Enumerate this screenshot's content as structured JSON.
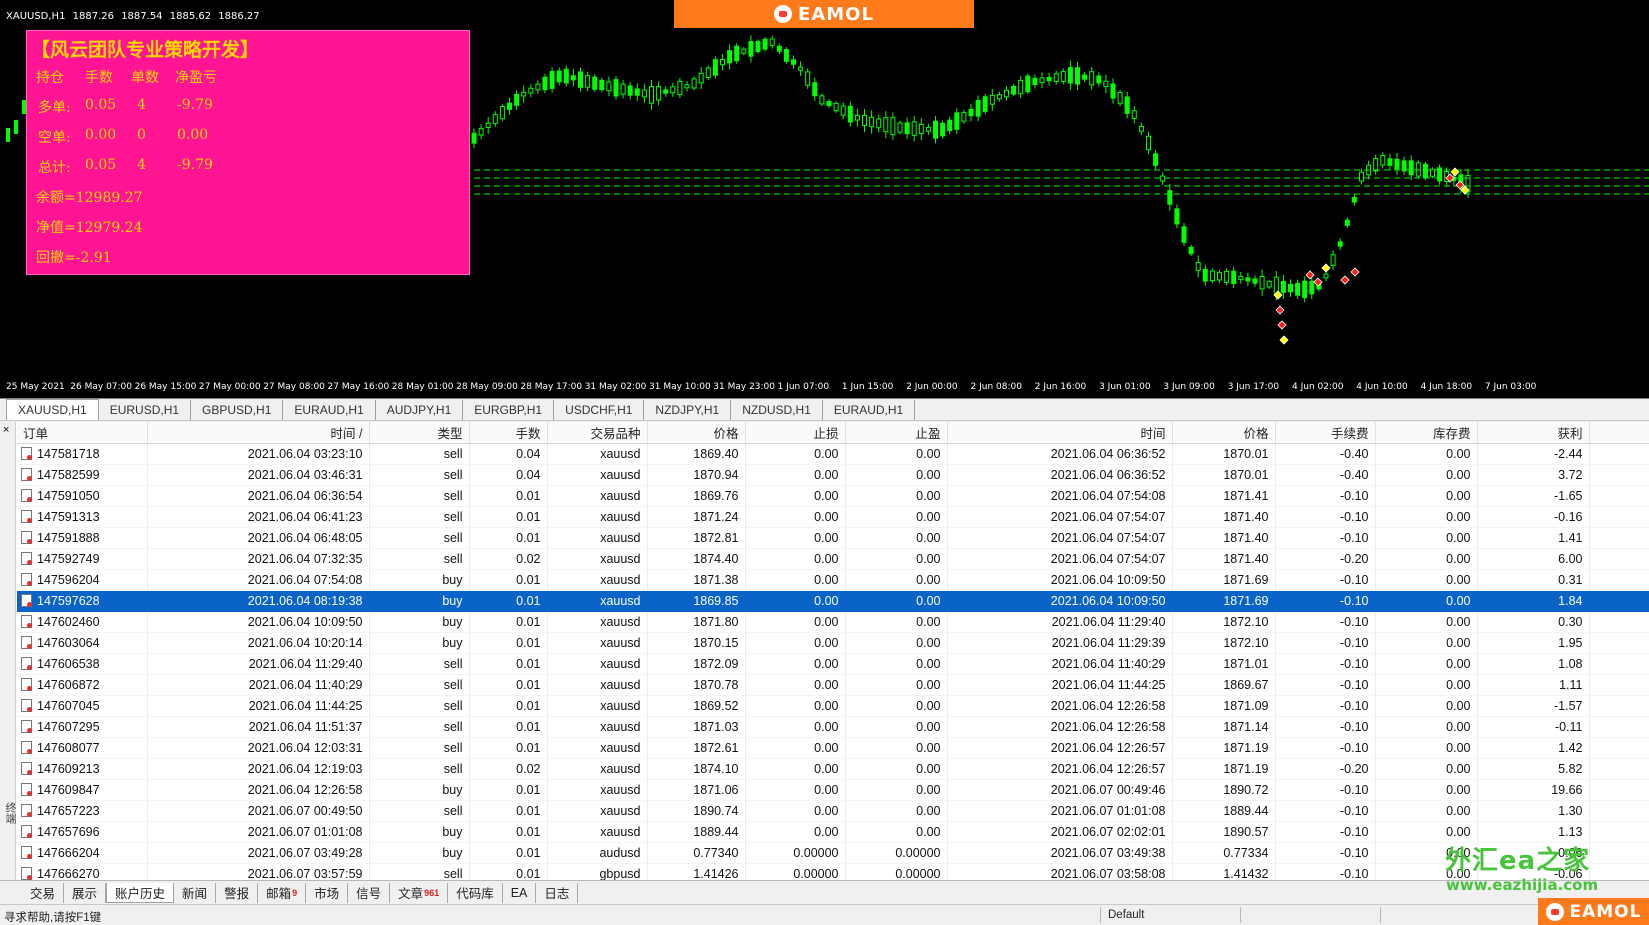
{
  "chart": {
    "symbol_label": "XAUUSD,H1",
    "ohlc": [
      "1887.26",
      "1887.54",
      "1885.62",
      "1886.27"
    ],
    "time_labels": [
      "25 May 2021",
      "26 May 07:00",
      "26 May 15:00",
      "27 May 00:00",
      "27 May 08:00",
      "27 May 16:00",
      "28 May 01:00",
      "28 May 09:00",
      "28 May 17:00",
      "31 May 02:00",
      "31 May 10:00",
      "31 May 23:00",
      "1 Jun 07:00",
      "1 Jun 15:00",
      "2 Jun 00:00",
      "2 Jun 08:00",
      "2 Jun 16:00",
      "3 Jun 01:00",
      "3 Jun 09:00",
      "3 Jun 17:00",
      "4 Jun 02:00",
      "4 Jun 10:00",
      "4 Jun 18:00",
      "7 Jun 03:00"
    ],
    "candle_color": "#00ff00",
    "background_color": "#000000"
  },
  "brand": {
    "name": "EAMOL",
    "color": "#ff7a1a"
  },
  "info_panel": {
    "title": "【风云团队专业策略开发】",
    "headers": [
      "持仓",
      "手数",
      "单数",
      "净盈亏"
    ],
    "rows": [
      {
        "label": "多单:",
        "lots": "0.05",
        "count": "4",
        "pnl": "-9.79"
      },
      {
        "label": "空单:",
        "lots": "0.00",
        "count": "0",
        "pnl": "0.00"
      },
      {
        "label": "总计:",
        "lots": "0.05",
        "count": "4",
        "pnl": "-9.79"
      }
    ],
    "balance": "余额=12989.27",
    "equity": "净值=12979.24",
    "drawdown": "回撤=-2.91",
    "bg_color": "#ff1493",
    "text_color": "#ffd700"
  },
  "symbol_tabs": [
    "XAUUSD,H1",
    "EURUSD,H1",
    "GBPUSD,H1",
    "EURAUD,H1",
    "AUDJPY,H1",
    "EURGBP,H1",
    "USDCHF,H1",
    "NZDJPY,H1",
    "NZDUSD,H1",
    "EURAUD,H1"
  ],
  "table": {
    "columns": [
      "订单",
      "时间",
      "类型",
      "手数",
      "交易品种",
      "价格",
      "止损",
      "止盈",
      "时间",
      "价格",
      "手续费",
      "库存费",
      "获利"
    ],
    "sort_marker": "/",
    "selected_order": "147597628",
    "rows": [
      [
        "147581718",
        "2021.06.04 03:23:10",
        "sell",
        "0.04",
        "xauusd",
        "1869.40",
        "0.00",
        "0.00",
        "2021.06.04 06:36:52",
        "1870.01",
        "-0.40",
        "0.00",
        "-2.44"
      ],
      [
        "147582599",
        "2021.06.04 03:46:31",
        "sell",
        "0.04",
        "xauusd",
        "1870.94",
        "0.00",
        "0.00",
        "2021.06.04 06:36:52",
        "1870.01",
        "-0.40",
        "0.00",
        "3.72"
      ],
      [
        "147591050",
        "2021.06.04 06:36:54",
        "sell",
        "0.01",
        "xauusd",
        "1869.76",
        "0.00",
        "0.00",
        "2021.06.04 07:54:08",
        "1871.41",
        "-0.10",
        "0.00",
        "-1.65"
      ],
      [
        "147591313",
        "2021.06.04 06:41:23",
        "sell",
        "0.01",
        "xauusd",
        "1871.24",
        "0.00",
        "0.00",
        "2021.06.04 07:54:07",
        "1871.40",
        "-0.10",
        "0.00",
        "-0.16"
      ],
      [
        "147591888",
        "2021.06.04 06:48:05",
        "sell",
        "0.01",
        "xauusd",
        "1872.81",
        "0.00",
        "0.00",
        "2021.06.04 07:54:07",
        "1871.40",
        "-0.10",
        "0.00",
        "1.41"
      ],
      [
        "147592749",
        "2021.06.04 07:32:35",
        "sell",
        "0.02",
        "xauusd",
        "1874.40",
        "0.00",
        "0.00",
        "2021.06.04 07:54:07",
        "1871.40",
        "-0.20",
        "0.00",
        "6.00"
      ],
      [
        "147596204",
        "2021.06.04 07:54:08",
        "buy",
        "0.01",
        "xauusd",
        "1871.38",
        "0.00",
        "0.00",
        "2021.06.04 10:09:50",
        "1871.69",
        "-0.10",
        "0.00",
        "0.31"
      ],
      [
        "147597628",
        "2021.06.04 08:19:38",
        "buy",
        "0.01",
        "xauusd",
        "1869.85",
        "0.00",
        "0.00",
        "2021.06.04 10:09:50",
        "1871.69",
        "-0.10",
        "0.00",
        "1.84"
      ],
      [
        "147602460",
        "2021.06.04 10:09:50",
        "buy",
        "0.01",
        "xauusd",
        "1871.80",
        "0.00",
        "0.00",
        "2021.06.04 11:29:40",
        "1872.10",
        "-0.10",
        "0.00",
        "0.30"
      ],
      [
        "147603064",
        "2021.06.04 10:20:14",
        "buy",
        "0.01",
        "xauusd",
        "1870.15",
        "0.00",
        "0.00",
        "2021.06.04 11:29:39",
        "1872.10",
        "-0.10",
        "0.00",
        "1.95"
      ],
      [
        "147606538",
        "2021.06.04 11:29:40",
        "sell",
        "0.01",
        "xauusd",
        "1872.09",
        "0.00",
        "0.00",
        "2021.06.04 11:40:29",
        "1871.01",
        "-0.10",
        "0.00",
        "1.08"
      ],
      [
        "147606872",
        "2021.06.04 11:40:29",
        "sell",
        "0.01",
        "xauusd",
        "1870.78",
        "0.00",
        "0.00",
        "2021.06.04 11:44:25",
        "1869.67",
        "-0.10",
        "0.00",
        "1.11"
      ],
      [
        "147607045",
        "2021.06.04 11:44:25",
        "sell",
        "0.01",
        "xauusd",
        "1869.52",
        "0.00",
        "0.00",
        "2021.06.04 12:26:58",
        "1871.09",
        "-0.10",
        "0.00",
        "-1.57"
      ],
      [
        "147607295",
        "2021.06.04 11:51:37",
        "sell",
        "0.01",
        "xauusd",
        "1871.03",
        "0.00",
        "0.00",
        "2021.06.04 12:26:58",
        "1871.14",
        "-0.10",
        "0.00",
        "-0.11"
      ],
      [
        "147608077",
        "2021.06.04 12:03:31",
        "sell",
        "0.01",
        "xauusd",
        "1872.61",
        "0.00",
        "0.00",
        "2021.06.04 12:26:57",
        "1871.19",
        "-0.10",
        "0.00",
        "1.42"
      ],
      [
        "147609213",
        "2021.06.04 12:19:03",
        "sell",
        "0.02",
        "xauusd",
        "1874.10",
        "0.00",
        "0.00",
        "2021.06.04 12:26:57",
        "1871.19",
        "-0.20",
        "0.00",
        "5.82"
      ],
      [
        "147609847",
        "2021.06.04 12:26:58",
        "buy",
        "0.01",
        "xauusd",
        "1871.06",
        "0.00",
        "0.00",
        "2021.06.07 00:49:46",
        "1890.72",
        "-0.10",
        "0.00",
        "19.66"
      ],
      [
        "147657223",
        "2021.06.07 00:49:50",
        "sell",
        "0.01",
        "xauusd",
        "1890.74",
        "0.00",
        "0.00",
        "2021.06.07 01:01:08",
        "1889.44",
        "-0.10",
        "0.00",
        "1.30"
      ],
      [
        "147657696",
        "2021.06.07 01:01:08",
        "buy",
        "0.01",
        "xauusd",
        "1889.44",
        "0.00",
        "0.00",
        "2021.06.07 02:02:01",
        "1890.57",
        "-0.10",
        "0.00",
        "1.13"
      ],
      [
        "147666204",
        "2021.06.07 03:49:28",
        "buy",
        "0.01",
        "audusd",
        "0.77340",
        "0.00000",
        "0.00000",
        "2021.06.07 03:49:38",
        "0.77334",
        "-0.10",
        "0.00",
        "-0.06"
      ],
      [
        "147666270",
        "2021.06.07 03:57:59",
        "sell",
        "0.01",
        "gbpusd",
        "1.41426",
        "0.00000",
        "0.00000",
        "2021.06.07 03:58:08",
        "1.41432",
        "-0.10",
        "0.00",
        "-0.06"
      ]
    ]
  },
  "bottom_tabs": [
    {
      "label": "交易"
    },
    {
      "label": "展示"
    },
    {
      "label": "账户历史",
      "active": true
    },
    {
      "label": "新闻"
    },
    {
      "label": "警报"
    },
    {
      "label": "邮箱",
      "badge": "9"
    },
    {
      "label": "市场"
    },
    {
      "label": "信号"
    },
    {
      "label": "文章",
      "badge": "961"
    },
    {
      "label": "代码库"
    },
    {
      "label": "EA"
    },
    {
      "label": "日志"
    }
  ],
  "side_label": "终端",
  "status": {
    "help": "寻求帮助,请按F1键",
    "profile": "Default"
  },
  "watermark": {
    "cn": "外汇ea之家",
    "url": "www.eazhijia.com"
  }
}
